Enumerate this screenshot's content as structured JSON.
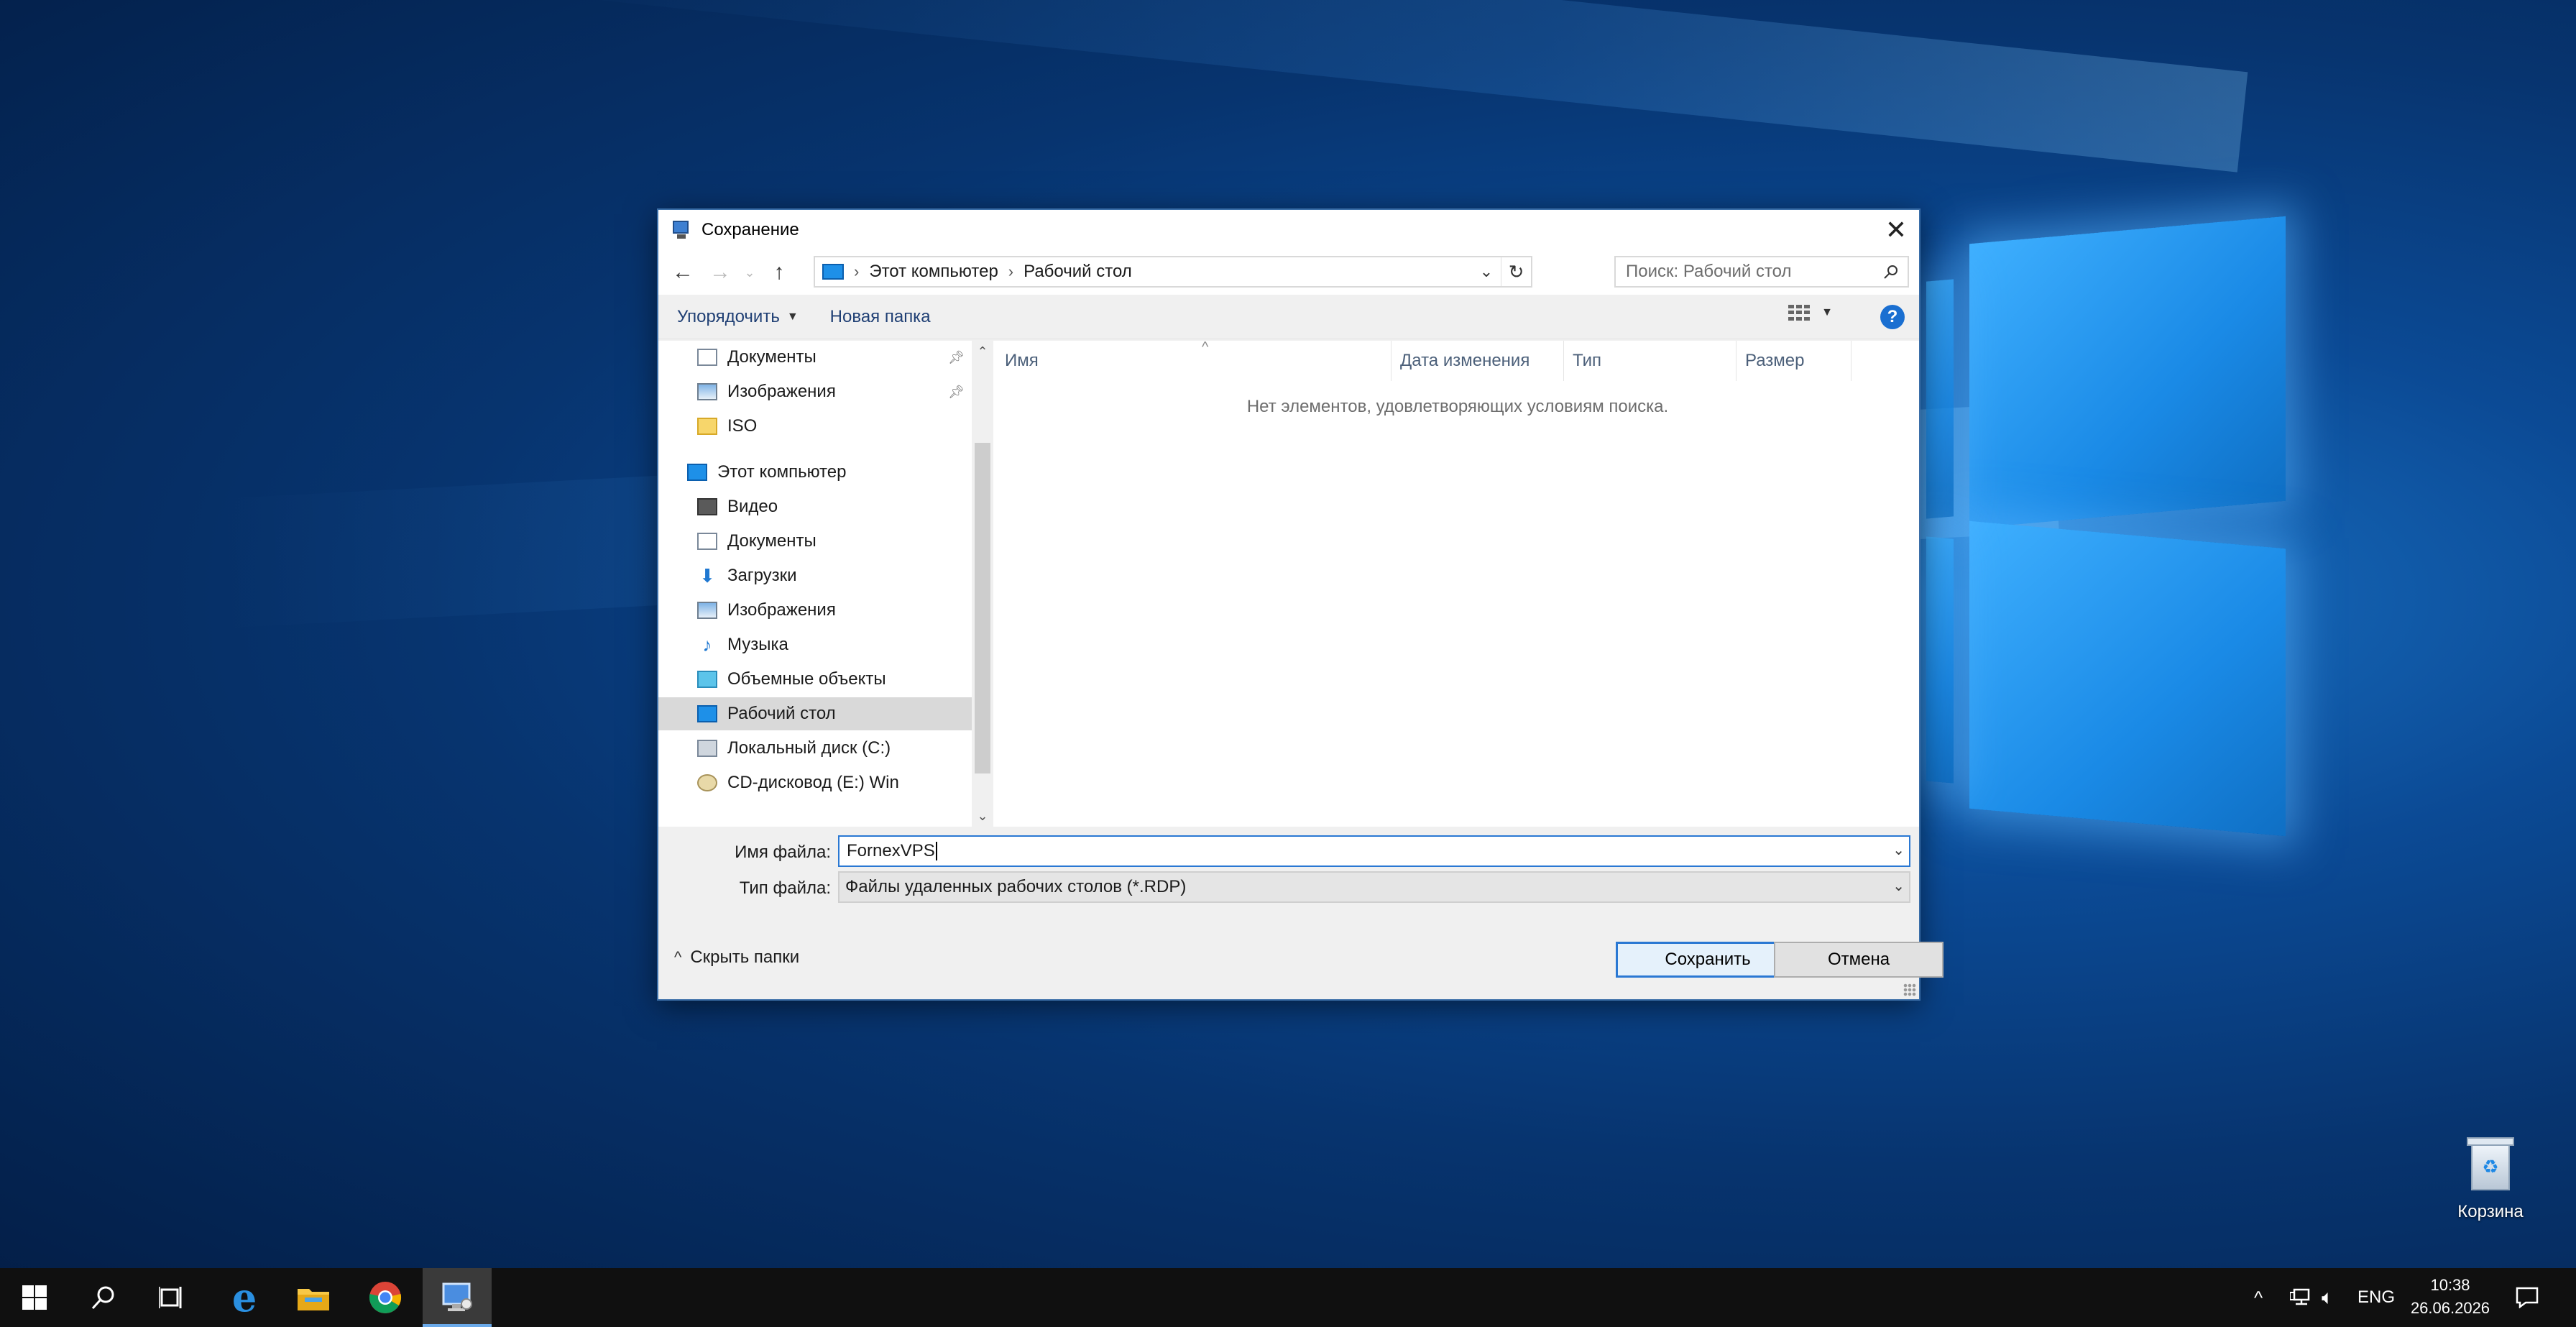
{
  "desktop": {
    "recycle_bin_label": "Корзина"
  },
  "dialog": {
    "title": "Сохранение",
    "address": {
      "crumbs": [
        "Этот компьютер",
        "Рабочий стол"
      ]
    },
    "search_placeholder": "Поиск: Рабочий стол",
    "toolbar": {
      "organize_label": "Упорядочить",
      "new_folder_label": "Новая папка",
      "help_label": "?"
    },
    "nav": {
      "items": [
        {
          "label": "Документы",
          "icon": "documents-icon",
          "pinned": true
        },
        {
          "label": "Изображения",
          "icon": "pictures-icon",
          "pinned": true
        },
        {
          "label": "ISO",
          "icon": "folder-icon",
          "pinned": false
        },
        {
          "label": "Этот компьютер",
          "icon": "computer-icon",
          "pinned": false
        },
        {
          "label": "Видео",
          "icon": "video-icon",
          "pinned": false
        },
        {
          "label": "Документы",
          "icon": "documents-icon",
          "pinned": false
        },
        {
          "label": "Загрузки",
          "icon": "downloads-icon",
          "pinned": false
        },
        {
          "label": "Изображения",
          "icon": "pictures-icon",
          "pinned": false
        },
        {
          "label": "Музыка",
          "icon": "music-icon",
          "pinned": false
        },
        {
          "label": "Объемные объекты",
          "icon": "3d-objects-icon",
          "pinned": false
        },
        {
          "label": "Рабочий стол",
          "icon": "desktop-icon",
          "pinned": false,
          "selected": true
        },
        {
          "label": "Локальный диск (C:)",
          "icon": "drive-icon",
          "pinned": false
        },
        {
          "label": "CD-дисковод (E:) Win",
          "icon": "cd-drive-icon",
          "pinned": false
        }
      ]
    },
    "columns": [
      "Имя",
      "Дата изменения",
      "Тип",
      "Размер"
    ],
    "empty_message": "Нет элементов, удовлетворяющих условиям поиска.",
    "filename_label": "Имя файла:",
    "filename_value": "FornexVPS",
    "filetype_label": "Тип файла:",
    "filetype_value": "Файлы удаленных рабочих столов (*.RDP)",
    "hide_folders_label": "Скрыть папки",
    "save_label": "Сохранить",
    "cancel_label": "Отмена"
  },
  "taskbar": {
    "apps": [
      "start-icon",
      "search-icon",
      "task-view-icon",
      "edge-icon",
      "file-explorer-icon",
      "chrome-icon",
      "remote-desktop-icon"
    ],
    "language": "ENG",
    "time": "10:38",
    "date": "26.06.2026"
  },
  "colors": {
    "accent": "#2a78d3",
    "taskbar": "#101010",
    "selection": "#d9d9d9"
  }
}
